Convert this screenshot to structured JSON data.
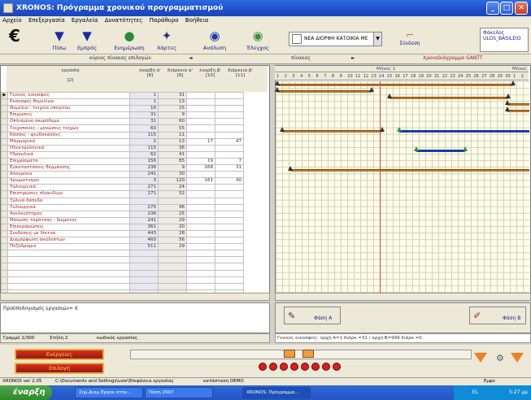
{
  "window": {
    "title": "XRONOS: Πρόγραμμα χρονικού προγραμματισμού"
  },
  "menu": [
    "Αρχείο",
    "Επεξεργασία",
    "Εργαλεία",
    "Δυνατότητες",
    "Παράθυρο",
    "Βοήθεια"
  ],
  "toolbar": {
    "euro_label": "€",
    "buttons": [
      {
        "label": "Πίσω",
        "icon": "down-arrow-icon"
      },
      {
        "label": "Εμπρός",
        "icon": "down-arrow-icon"
      },
      {
        "label": "Ενημέρωση",
        "icon": "globe-icon"
      },
      {
        "label": "Χάρτες",
        "icon": "map-icon"
      },
      {
        "label": "Ανάλυση",
        "icon": "analysis-icon"
      },
      {
        "label": "Έλεγχος",
        "icon": "check-icon"
      }
    ],
    "vessel_select": "ΝΕΑ ΔΙΟΡΦΗ ΚΑΤΟΙΚΙΑ ΜΕ",
    "connect_label": "Σύνδεση",
    "file_box": {
      "line1": "Φάκελος",
      "line2": "ULOS_BASILEIO"
    }
  },
  "tab_header": {
    "left": "κύριος πίνακας επιλογών",
    "mid": "πίνακας",
    "right": "Χρονοδιάγραμμα GANTT"
  },
  "table": {
    "columns": [
      {
        "title": "εργασία",
        "sub": "[2]"
      },
      {
        "title": "έναρξη α'",
        "sub": "[8]"
      },
      {
        "title": "διάρκεια α'",
        "sub": "[9]"
      },
      {
        "title": "έναρξη β'",
        "sub": "[10]"
      },
      {
        "title": "διάρκεια β'",
        "sub": "[11]"
      }
    ],
    "rows": [
      {
        "name": "Γενικές οικοσφείς",
        "s1": "1",
        "d1": "31",
        "s2": "",
        "d2": ""
      },
      {
        "name": "Εκσκαφές θεμελίων",
        "s1": "1",
        "d1": "13",
        "s2": "",
        "d2": ""
      },
      {
        "name": "Θεμέλια - τοιχεία υπογείου",
        "s1": "16",
        "d1": "15",
        "s2": "",
        "d2": ""
      },
      {
        "name": "Επιχώσεις",
        "s1": "31",
        "d1": "9",
        "s2": "",
        "d2": ""
      },
      {
        "name": "Οπλισμένο σκυρόδεμα",
        "s1": "31",
        "d1": "60",
        "s2": "",
        "d2": ""
      },
      {
        "name": "Τοιχοποιίες - μονώσεις τοίχων",
        "s1": "60",
        "d1": "55",
        "s2": "",
        "d2": ""
      },
      {
        "name": "Κάσσες - ψευδοκάσσες",
        "s1": "115",
        "d1": "11",
        "s2": "",
        "d2": ""
      },
      {
        "name": "Μαρμαρικά",
        "s1": "2",
        "d1": "13",
        "s2": "17",
        "d2": "47"
      },
      {
        "name": "Ηλεκτρολογικά",
        "s1": "115",
        "d1": "36",
        "s2": "",
        "d2": ""
      },
      {
        "name": "Υδραυλικά",
        "s1": "62",
        "d1": "41",
        "s2": "",
        "d2": ""
      },
      {
        "name": "Επιχρίσματα",
        "s1": "156",
        "d1": "85",
        "s2": "19",
        "d2": "7"
      },
      {
        "name": "Εγκαταστάσεις θέρμανσης",
        "s1": "236",
        "d1": "9",
        "s2": "268",
        "d2": "31"
      },
      {
        "name": "Αλουμίνια",
        "s1": "241",
        "d1": "30",
        "s2": "",
        "d2": ""
      },
      {
        "name": "Χρωματισμοί",
        "s1": "3",
        "d1": "120",
        "s2": "161",
        "d2": "40"
      },
      {
        "name": "Υαλουργικά",
        "s1": "271",
        "d1": "24",
        "s2": "",
        "d2": ""
      },
      {
        "name": "Επιστρώσεις πλακιδίων",
        "s1": "271",
        "d1": "52",
        "s2": "",
        "d2": ""
      },
      {
        "name": "Ξύλινα δάπεδα",
        "s1": "",
        "d1": "",
        "s2": "",
        "d2": ""
      },
      {
        "name": "Ξυλουργικά",
        "s1": "275",
        "d1": "46",
        "s2": "",
        "d2": ""
      },
      {
        "name": "Ανελκυστήρας",
        "s1": "236",
        "d1": "25",
        "s2": "",
        "d2": ""
      },
      {
        "name": "Μόνωση ταράτσας - δώματος",
        "s1": "241",
        "d1": "29",
        "s2": "",
        "d2": ""
      },
      {
        "name": "Επικεραμώσεις",
        "s1": "361",
        "d1": "20",
        "s2": "",
        "d2": ""
      },
      {
        "name": "Συνδέσεις με δίκτυα",
        "s1": "443",
        "d1": "28",
        "s2": "",
        "d2": ""
      },
      {
        "name": "Διαμόρφωση ακαλύπτων",
        "s1": "460",
        "d1": "56",
        "s2": "",
        "d2": ""
      },
      {
        "name": "Πεζοδρόμιο",
        "s1": "511",
        "d1": "29",
        "s2": "",
        "d2": ""
      },
      {
        "name": "",
        "s1": "",
        "d1": "",
        "s2": "",
        "d2": ""
      },
      {
        "name": "",
        "s1": "",
        "d1": "",
        "s2": "",
        "d2": ""
      },
      {
        "name": "",
        "s1": "",
        "d1": "",
        "s2": "",
        "d2": ""
      },
      {
        "name": "",
        "s1": "",
        "d1": "",
        "s2": "",
        "d2": ""
      },
      {
        "name": "",
        "s1": "",
        "d1": "",
        "s2": "",
        "d2": ""
      },
      {
        "name": "",
        "s1": "",
        "d1": "",
        "s2": "",
        "d2": ""
      },
      {
        "name": "",
        "s1": "",
        "d1": "",
        "s2": "",
        "d2": ""
      }
    ]
  },
  "gantt": {
    "month1": "Μήνας 1",
    "month2": "Μήνας 2",
    "days": [
      "1",
      "2",
      "3",
      "4",
      "5",
      "6",
      "7",
      "8",
      "9",
      "10",
      "11",
      "12",
      "13",
      "14",
      "15",
      "16",
      "17",
      "18",
      "19",
      "20",
      "21",
      "22",
      "23",
      "24",
      "25",
      "26",
      "27",
      "28",
      "29",
      "30",
      "1",
      "2"
    ]
  },
  "budget": {
    "label": "Προϋπολογισμός εργασιών= €"
  },
  "status_left": {
    "row": "Γραμμή 1/300",
    "col": "Στήλη 2",
    "field": "κωδικός εργασίας"
  },
  "phase": {
    "a_label": "Φάση Α",
    "b_label": "Φάση Β"
  },
  "status_right": "Γενικές οικοσφείς: αρχή Α=1 διάρκ.=31 / αρχή Β=999 διάρκ.=0",
  "bottom": {
    "red_btn_1": "Ενέργειες",
    "red_btn_2": "Επιλογή"
  },
  "pathbar": {
    "version": "XRONOS ver 2.05",
    "path": "C:\\Documents and Settings\\user\\Επιφάνεια εργασίας",
    "state": "κατάσταση DEMO",
    "right": "Εμφύ"
  },
  "taskbar": {
    "start": "έναρξη",
    "items": [
      "Σημ.Διαμ.Έργου στην...",
      "Πάση 2007",
      "XRONOS: Πρόγραμμα..."
    ],
    "lang": "EL",
    "clock": "5:27 μμ"
  }
}
